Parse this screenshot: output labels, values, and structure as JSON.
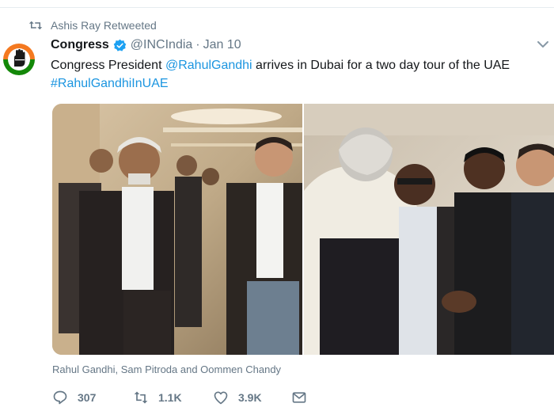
{
  "retweet_banner": {
    "text": "Ashis Ray Retweeted",
    "icon": "retweet-icon"
  },
  "author": {
    "name": "Congress",
    "handle": "@INCIndia",
    "separator": "·",
    "date": "Jan 10",
    "verified": true
  },
  "tweet": {
    "text_before": "Congress President ",
    "mention": "@RahulGandhi",
    "text_after": " arrives in Dubai for a two day tour of the UAE",
    "hashtag": "#RahulGandhiInUAE"
  },
  "media": {
    "caption": "Rahul Gandhi, Sam Pitroda and Oommen Chandy",
    "photos": [
      {
        "name": "photo-walking-group"
      },
      {
        "name": "photo-handshake-group"
      }
    ]
  },
  "actions": {
    "reply_count": "307",
    "retweet_count": "1.1K",
    "like_count": "3.9K"
  },
  "colors": {
    "link": "#1b95e0",
    "muted": "#657786",
    "brand_orange": "#f47920",
    "brand_green": "#138808"
  }
}
